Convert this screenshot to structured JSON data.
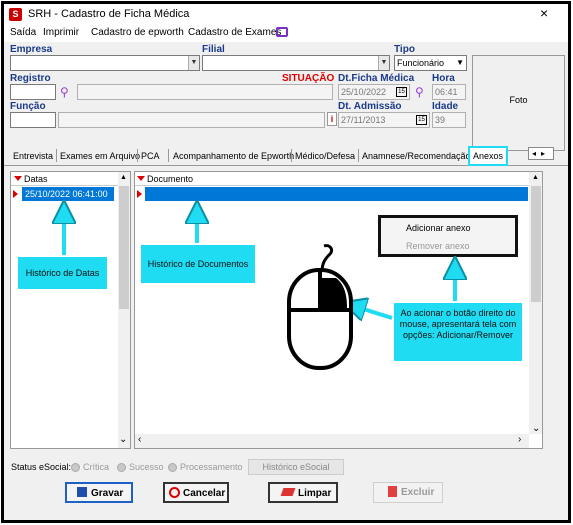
{
  "window": {
    "title": "SRH - Cadastro de Ficha Médica",
    "close": "×"
  },
  "menu": [
    "Saída",
    "Imprimir",
    "Cadastro de epworth",
    "Cadastro de Exames"
  ],
  "form": {
    "empresa_label": "Empresa",
    "filial_label": "Filial",
    "tipo_label": "Tipo",
    "tipo_value": "Funcionário",
    "registro_label": "Registro",
    "situacao_label": "SITUAÇÃO",
    "dtficha_label": "Dt.Ficha Médica",
    "dtficha_value": "25/10/2022",
    "cal_icon": "15",
    "hora_label": "Hora",
    "hora_value": "06:41",
    "funcao_label": "Função",
    "dtadmissao_label": "Dt. Admissão",
    "dtadmissao_value": "27/11/2013",
    "idade_label": "Idade",
    "idade_value": "39",
    "info_icon": "i",
    "foto_label": "Foto"
  },
  "tabs": [
    "Entrevista",
    "Exames em Arquivo",
    "PCA",
    "Acompanhamento de Epworth",
    "Médico/Defesa",
    "Anamnese/Recomendação",
    "Anexos"
  ],
  "left_panel": {
    "header": "Datas",
    "row": "25/10/2022 06:41:00"
  },
  "right_panel": {
    "header": "Documento"
  },
  "context_menu": {
    "add": "Adicionar anexo",
    "remove": "Remover anexo"
  },
  "callouts": {
    "datas": "Histórico de Datas",
    "docs": "Histórico de Documentos",
    "mouse": "Ao acionar o botão direito do mouse, apresentará tela com opções: Adicionar/Remover"
  },
  "status": {
    "label": "Status eSocial:",
    "opt1": "Crítica",
    "opt2": "Sucesso",
    "opt3": "Processamento",
    "button": "Histórico eSocial"
  },
  "buttons": {
    "save": "Gravar",
    "cancel": "Cancelar",
    "clear": "Limpar",
    "delete": "Excluir"
  },
  "colors": {
    "accent": "#1fdcf3",
    "selection": "#0078d7",
    "situacao": "#d00000",
    "label": "#1a3a8a"
  }
}
